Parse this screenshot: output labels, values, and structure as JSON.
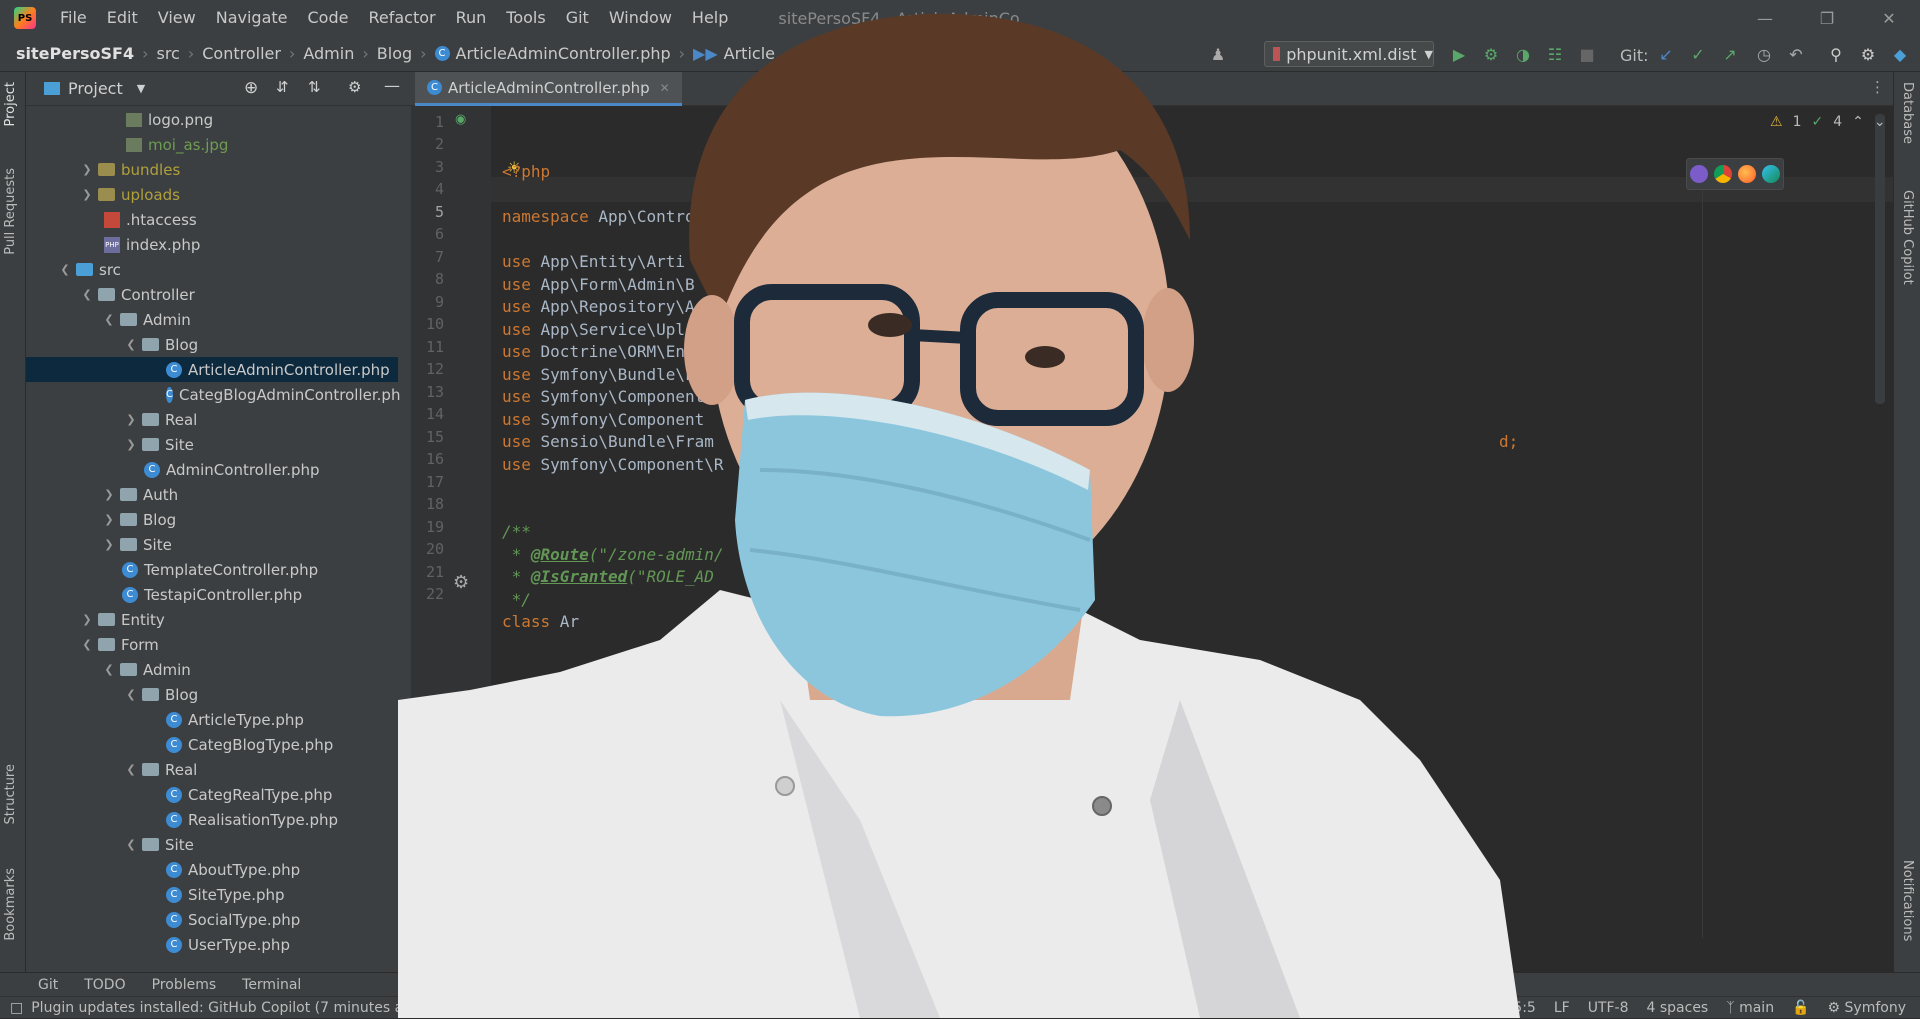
{
  "app": {
    "window_title": "sitePersoSF4 - ArticleAdminCo",
    "menu": [
      "File",
      "Edit",
      "View",
      "Navigate",
      "Code",
      "Refactor",
      "Run",
      "Tools",
      "Git",
      "Window",
      "Help"
    ]
  },
  "navbar": {
    "project": "sitePersoSF4",
    "crumbs": [
      "src",
      "Controller",
      "Admin",
      "Blog",
      "ArticleAdminController.php",
      "Article"
    ],
    "run_config": "phpunit.xml.dist",
    "git_label": "Git:"
  },
  "left_strip": {
    "project": "Project",
    "pull_requests": "Pull Requests",
    "structure": "Structure",
    "bookmarks": "Bookmarks"
  },
  "right_strip": {
    "database": "Database",
    "copilot": "GitHub Copilot",
    "notifications": "Notifications"
  },
  "project_panel": {
    "title": "Project",
    "rows": [
      {
        "label": "logo.png"
      },
      {
        "label": "moi_as.jpg"
      },
      {
        "label": "bundles"
      },
      {
        "label": "uploads"
      },
      {
        "label": ".htaccess"
      },
      {
        "label": "index.php"
      },
      {
        "label": "src"
      },
      {
        "label": "Controller"
      },
      {
        "label": "Admin"
      },
      {
        "label": "Blog"
      },
      {
        "label": "ArticleAdminController.php"
      },
      {
        "label": "CategBlogAdminController.ph"
      },
      {
        "label": "Real"
      },
      {
        "label": "Site"
      },
      {
        "label": "AdminController.php"
      },
      {
        "label": "Auth"
      },
      {
        "label": "Blog"
      },
      {
        "label": "Site"
      },
      {
        "label": "TemplateController.php"
      },
      {
        "label": "TestapiController.php"
      },
      {
        "label": "Entity"
      },
      {
        "label": "Form"
      },
      {
        "label": "Admin"
      },
      {
        "label": "Blog"
      },
      {
        "label": "ArticleType.php"
      },
      {
        "label": "CategBlogType.php"
      },
      {
        "label": "Real"
      },
      {
        "label": "CategRealType.php"
      },
      {
        "label": "RealisationType.php"
      },
      {
        "label": "Site"
      },
      {
        "label": "AboutType.php"
      },
      {
        "label": "SiteType.php"
      },
      {
        "label": "SocialType.php"
      },
      {
        "label": "UserType.php"
      }
    ]
  },
  "editor": {
    "tab": "ArticleAdminController.php",
    "warnings": "1",
    "checks": "4",
    "line_numbers": [
      "1",
      "2",
      "3",
      "4",
      "5",
      "6",
      "7",
      "8",
      "9",
      "10",
      "11",
      "12",
      "13",
      "14",
      "15",
      "16",
      "17",
      "18",
      "19",
      "20",
      "21",
      "22"
    ],
    "code": {
      "l1": "<?php",
      "l3a": "namespace",
      "l3b": " App\\Contro",
      "l5a": "use",
      "l5b": " App\\Entity\\Arti",
      "l6a": "use",
      "l6b": " App\\Form\\Admin\\B",
      "l7a": "use",
      "l7b": " App\\Repository\\A",
      "l8a": "use",
      "l8b": " App\\Service\\Uplo",
      "l9a": "use",
      "l9b": " Doctrine\\ORM\\Ent",
      "l10a": "use",
      "l10b": " Symfony\\Bundle\\Fr",
      "l11a": "use",
      "l11b": " Symfony\\Component",
      "l12a": "use",
      "l12b": " Symfony\\Component",
      "l13a": "use",
      "l13b": " Sensio\\Bundle\\Fram",
      "l13c": "d;",
      "l14a": "use",
      "l14b": " Symfony\\Component\\R",
      "l17": "/**",
      "l18a": " * ",
      "l18b": "@Route",
      "l18c": "(\"/zone-admin/",
      "l19a": " * ",
      "l19b": "@IsGranted",
      "l19c": "(\"ROLE_AD",
      "l20": " */",
      "l21a": "class",
      "l21b": " Ar"
    }
  },
  "toolwindows": [
    "Git",
    "TODO",
    "Problems",
    "Terminal"
  ],
  "status": {
    "message": "Plugin updates installed: GitHub Copilot (7 minutes ago)",
    "position": "5:5",
    "line_sep": "LF",
    "encoding": "UTF-8",
    "indent": "4 spaces",
    "branch": "main",
    "framework": "Symfony"
  },
  "colors": {
    "accent": "#4a88c7",
    "selection": "#0d293e",
    "background": "#2b2b2b"
  }
}
